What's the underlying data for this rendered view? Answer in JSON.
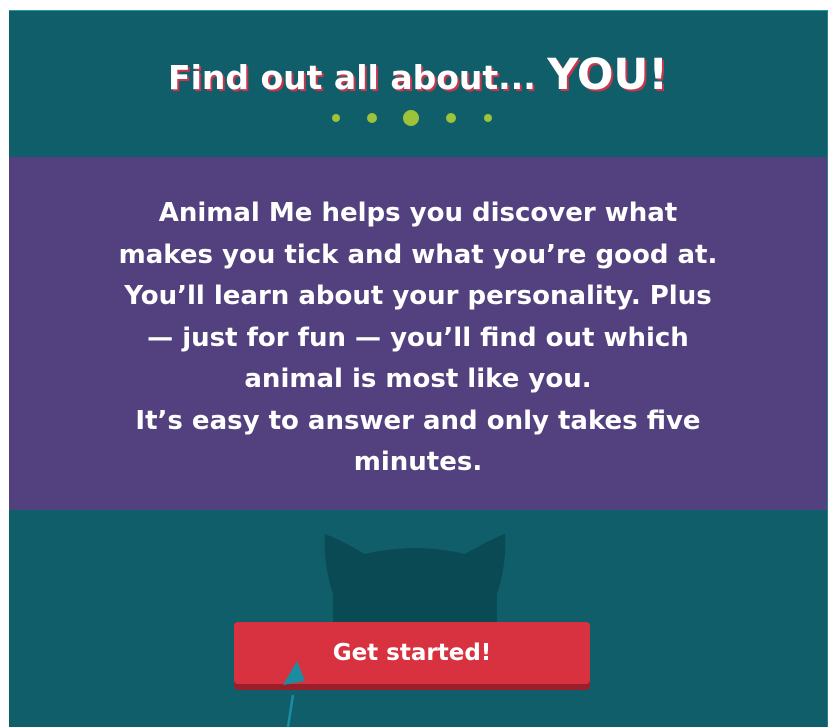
{
  "header": {
    "headline_prefix": "Find out all about... ",
    "headline_emphasis": "YOU!"
  },
  "intro": {
    "lines": [
      "Animal Me helps you discover what",
      "makes you tick and what you’re good at.",
      "You’ll learn about your personality. Plus",
      "— just for fun — you’ll find out which",
      "animal is most like you.",
      "It’s easy to answer and only takes five",
      "minutes."
    ]
  },
  "cta": {
    "label": "Get started!"
  },
  "icons": {
    "progress_dots": "dots-divider-icon",
    "cat_silhouette": "cat-silhouette-icon",
    "pointer": "mouse-cursor-icon"
  },
  "colors": {
    "page_background": "#0f5e6a",
    "banner_background": "#53407e",
    "dot_accent": "#9cc33a",
    "button_red": "#d8313f",
    "button_shadow": "#9b1f2b",
    "title_shadow": "#c8364b",
    "silhouette": "#0a4a55"
  }
}
